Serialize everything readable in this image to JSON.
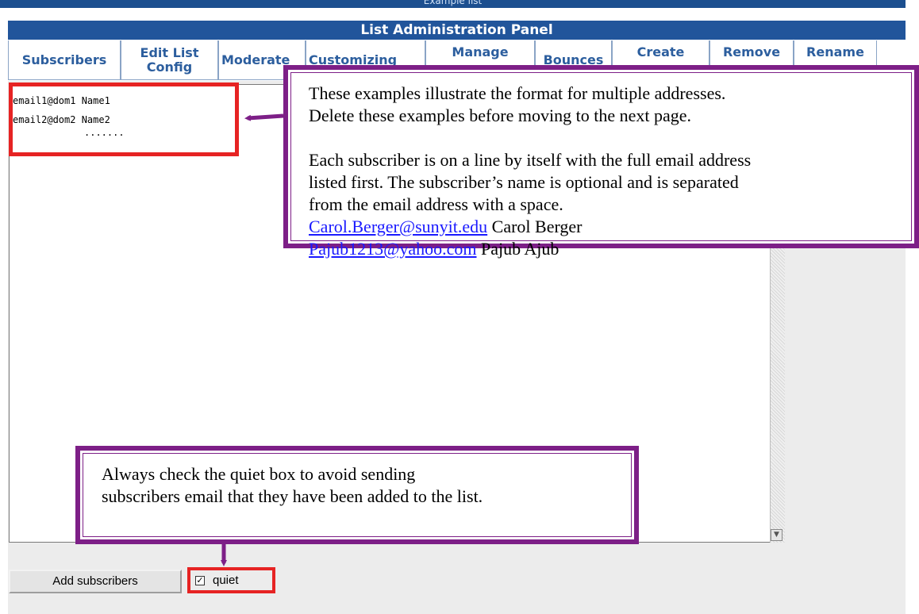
{
  "window": {
    "title_fragment": "Example list"
  },
  "panel": {
    "title": "List Administration Panel"
  },
  "tabs": [
    {
      "label": "Subscribers"
    },
    {
      "label": "Edit List Config"
    },
    {
      "label": "Moderate"
    },
    {
      "label": "Customizing"
    },
    {
      "label": "Manage"
    },
    {
      "label": "Bounces"
    },
    {
      "label": "Create"
    },
    {
      "label": "Remove"
    },
    {
      "label": "Rename"
    }
  ],
  "textarea": {
    "lines": [
      "email1@dom1 Name1",
      "email2@dom2 Name2"
    ],
    "ellipsis": "......."
  },
  "buttons": {
    "add_subscribers": "Add subscribers"
  },
  "quiet": {
    "label": "quiet",
    "checked": true,
    "checkmark": "☑"
  },
  "callout_top": {
    "para1_line1": "These examples illustrate the format for multiple addresses.",
    "para1_line2": "Delete these examples before moving to the next page.",
    "para2_line1": "Each subscriber is on a line by itself with the full email address",
    "para2_line2": "listed first.  The subscriber’s name is optional and is separated",
    "para2_line3": "from the email address with a space.",
    "example1_email": "Carol.Berger@sunyit.edu",
    "example1_name": " Carol Berger",
    "example2_email": "Pajub1213@yahoo.com",
    "example2_name": " Pajub Ajub"
  },
  "callout_bottom": {
    "line1": "Always check the quiet box to avoid sending",
    "line2": "subscribers email that they have been added to the list."
  },
  "colors": {
    "header_blue": "#21559b",
    "tab_text": "#2c5e9e",
    "callout_border": "#7d1f87",
    "highlight_red": "#e62323",
    "link_blue": "#1a1aff"
  }
}
